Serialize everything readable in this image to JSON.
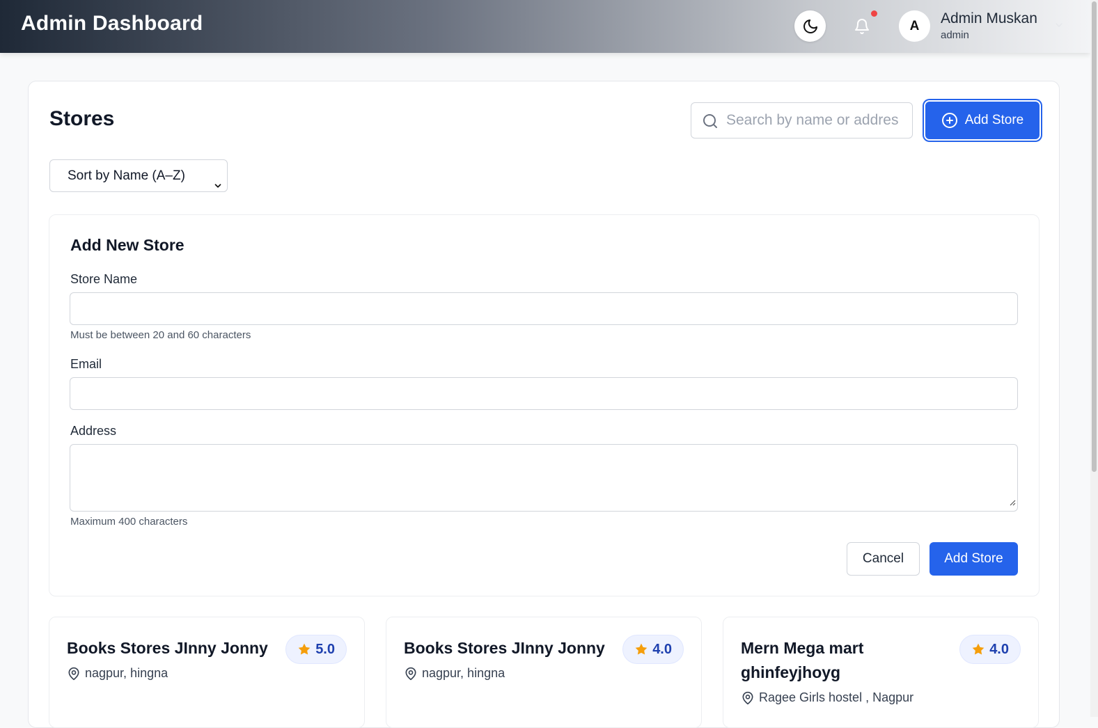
{
  "header": {
    "title": "Admin Dashboard",
    "user_initial": "A",
    "user_name": "Admin Muskan",
    "user_role": "admin"
  },
  "page": {
    "title": "Stores",
    "search_placeholder": "Search by name or address",
    "add_store_label": "Add Store",
    "sort_selected": "Sort by Name (A–Z)"
  },
  "form": {
    "title": "Add New Store",
    "store_name_label": "Store Name",
    "store_name_value": "",
    "store_name_hint": "Must be between 20 and 60 characters",
    "email_label": "Email",
    "email_value": "",
    "address_label": "Address",
    "address_value": "",
    "address_hint": "Maximum 400 characters",
    "cancel_label": "Cancel",
    "submit_label": "Add Store"
  },
  "stores": [
    {
      "name": "Books Stores JInny Jonny",
      "rating": "5.0",
      "address": "nagpur, hingna"
    },
    {
      "name": "Books Stores JInny Jonny",
      "rating": "4.0",
      "address": "nagpur, hingna"
    },
    {
      "name": "Mern Mega mart ghinfeyjhoyg",
      "rating": "4.0",
      "address": "Ragee Girls hostel , Nagpur"
    }
  ],
  "colors": {
    "primary": "#2563eb",
    "star": "#f59e0b",
    "notification_dot": "#ef4444"
  },
  "icons": [
    "moon-icon",
    "bell-icon",
    "chevron-down-icon",
    "search-icon",
    "plus-circle-icon",
    "star-icon",
    "map-pin-icon"
  ]
}
